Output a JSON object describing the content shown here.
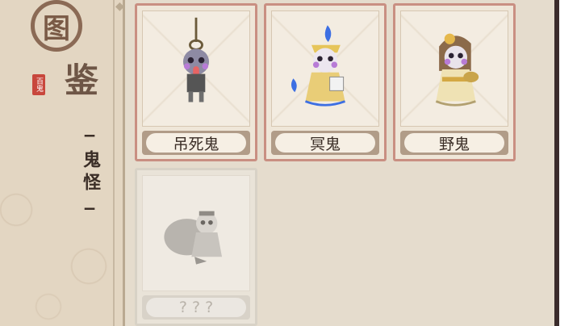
{
  "sidebar": {
    "title_char_1": "图",
    "title_char_2": "鉴",
    "seal_text": "百鬼",
    "category": "鬼怪"
  },
  "cards": [
    {
      "name": "吊死鬼",
      "unlocked": true,
      "icon": "hanged-ghost-icon"
    },
    {
      "name": "冥鬼",
      "unlocked": true,
      "icon": "underworld-ghost-icon"
    },
    {
      "name": "野鬼",
      "unlocked": true,
      "icon": "wild-ghost-icon"
    },
    {
      "name": "? ? ?",
      "unlocked": false,
      "icon": "locked-ghost-silhouette-icon"
    }
  ],
  "colors": {
    "card_border_unlocked": "#c98f82",
    "card_border_locked": "#d8d2c6",
    "seal": "#c8473c"
  }
}
